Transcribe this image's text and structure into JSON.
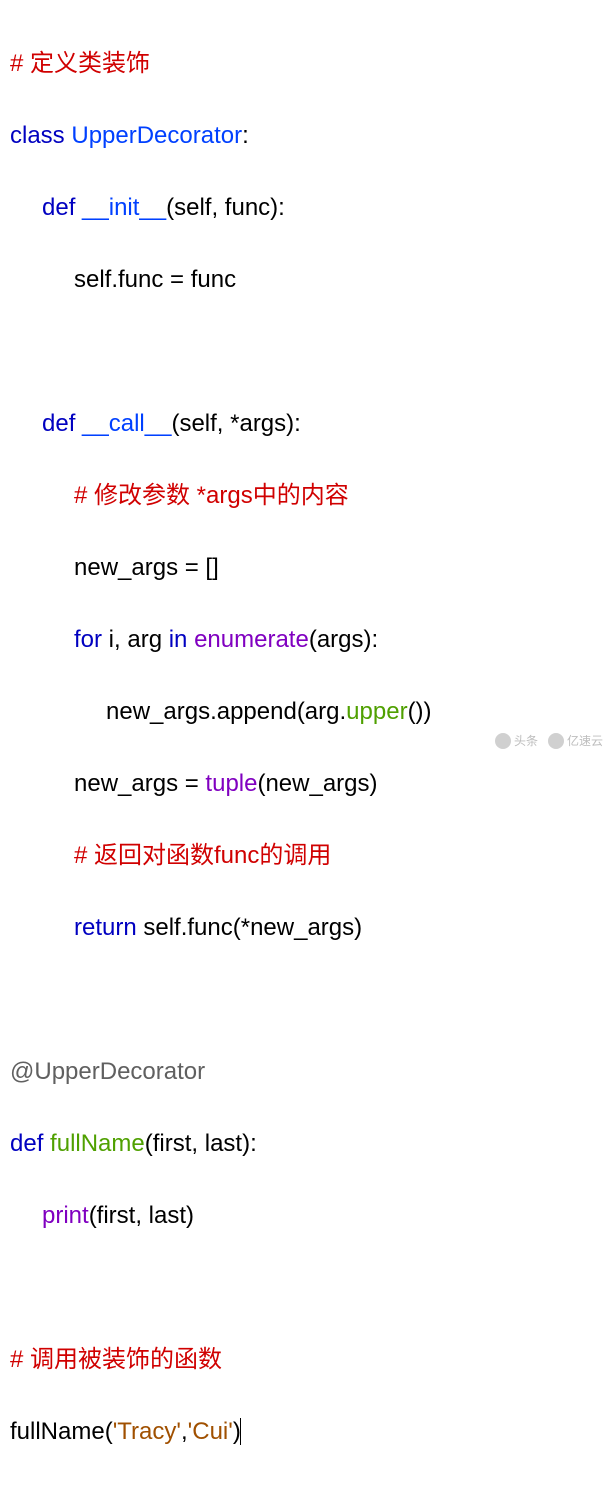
{
  "code": {
    "comment1": "# 定义类装饰",
    "kw_class": "class",
    "classname": "UpperDecorator",
    "colon": ":",
    "kw_def": "def",
    "dunder_init": "__init__",
    "init_params": "(self, func):",
    "init_body": "self.func = func",
    "dunder_call": "__call__",
    "call_params": "(self, *args):",
    "comment2": "# 修改参数 *args中的内容",
    "newargs_empty": "new_args = []",
    "kw_for": "for",
    "for_vars": " i, arg ",
    "kw_in": "in",
    "enum_call": "enumerate",
    "enum_arg": "(args):",
    "append_line_a": "new_args.append(arg.",
    "append_upper": "upper",
    "append_line_b": "())",
    "newargs_tuple_a": "new_args = ",
    "tuple_call": "tuple",
    "newargs_tuple_b": "(new_args)",
    "comment3": "# 返回对函数func的调用",
    "kw_return": "return",
    "return_expr": " self.func(*new_args)",
    "decorator_at": "@UpperDecorator",
    "fn_name": "fullName",
    "fn_params": "(first, last):",
    "print_call": "print",
    "print_args": "(first, last)",
    "comment4": "# 调用被装饰的函数",
    "call_fn_a": "fullName(",
    "str1": "'Tracy'",
    "comma": ",",
    "str2": "'Cui'",
    "call_fn_b": ")"
  },
  "watermark": {
    "left": "头条",
    "right": "亿速云"
  }
}
